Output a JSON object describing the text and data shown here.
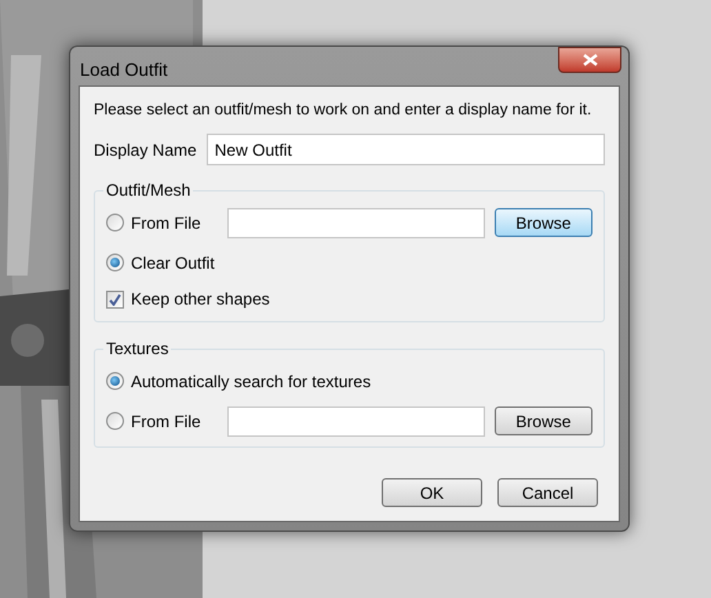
{
  "window": {
    "title": "Load Outfit"
  },
  "instruction": "Please select an outfit/mesh to work on and enter a display name for it.",
  "display_name": {
    "label": "Display Name",
    "value": "New Outfit"
  },
  "groups": [
    {
      "title": "Outfit/Mesh",
      "options": [
        {
          "kind": "file",
          "label": "From File",
          "selected": false,
          "button": {
            "label": "Browse",
            "highlighted": true
          }
        },
        {
          "kind": "plain",
          "label": "Clear Outfit",
          "selected": true
        }
      ],
      "checkbox": {
        "label": "Keep other shapes",
        "checked": true
      }
    },
    {
      "title": "Textures",
      "options": [
        {
          "kind": "plain",
          "label": "Automatically search for textures",
          "selected": true
        },
        {
          "kind": "file",
          "label": "From File",
          "selected": false,
          "button": {
            "label": "Browse",
            "highlighted": false
          }
        }
      ]
    }
  ],
  "buttons": [
    {
      "label": "OK"
    },
    {
      "label": "Cancel"
    }
  ]
}
